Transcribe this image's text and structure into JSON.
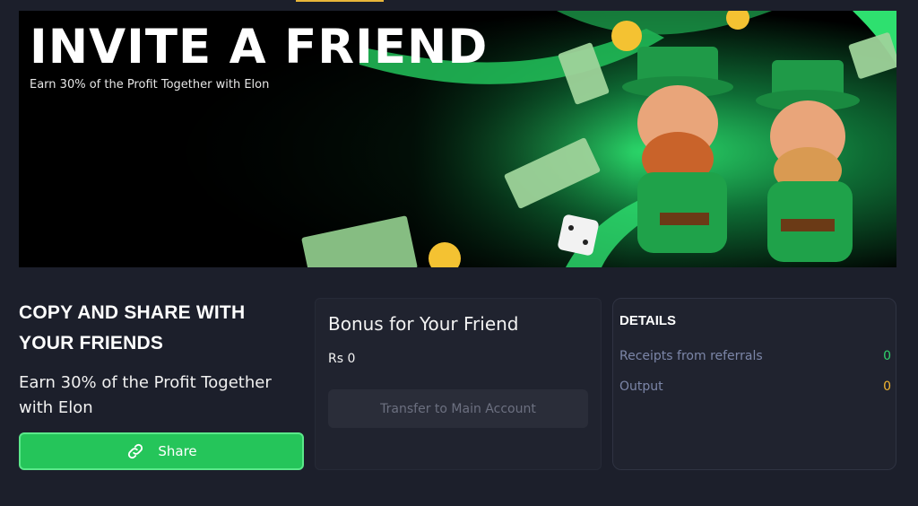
{
  "banner": {
    "title": "INVITE A FRIEND",
    "subtitle": "Earn 30% of the Profit Together with Elon"
  },
  "share_section": {
    "heading": "COPY AND SHARE WITH YOUR FRIENDS",
    "description": "Earn 30% of the Profit Together with Elon",
    "share_label": "Share",
    "share_icon": "link-icon"
  },
  "bonus_card": {
    "title": "Bonus for Your Friend",
    "amount": "Rs 0",
    "transfer_label": "Transfer to Main Account"
  },
  "details_card": {
    "heading": "DETAILS",
    "rows": [
      {
        "label": "Receipts from referrals",
        "value": "0",
        "color": "#2fd36b"
      },
      {
        "label": "Output",
        "value": "0",
        "color": "#f2b531"
      }
    ]
  },
  "colors": {
    "accent_green": "#25c55a",
    "background": "#1c1f2b",
    "card": "#20232f"
  }
}
